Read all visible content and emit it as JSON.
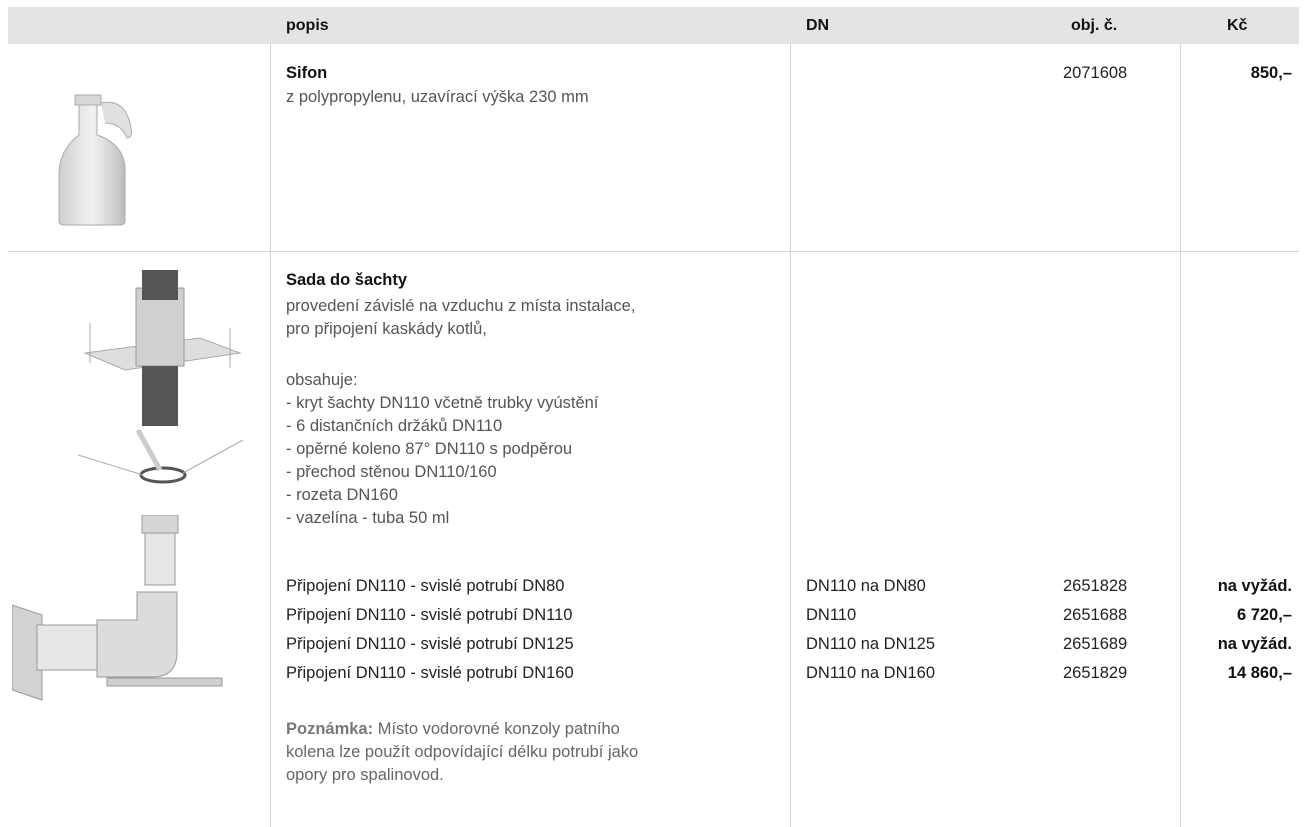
{
  "header": {
    "col_popis": "popis",
    "col_dn": "DN",
    "col_obj": "obj. č.",
    "col_kc": "Kč"
  },
  "items": [
    {
      "title": "Sifon",
      "description": "z polypropylenu, uzavírací výška 230 mm",
      "obj": "2071608",
      "price": "850,–"
    },
    {
      "title": "Sada do šachty",
      "description_lines": [
        "provedení závislé na vzduchu z místa instalace,",
        "pro připojení kaskády kotlů,"
      ],
      "contains_label": "obsahuje:",
      "contents": [
        "- kryt šachty DN110 včetně trubky vyústění",
        "- 6 distančních držáků DN110",
        "- opěrné koleno 87° DN110 s podpěrou",
        "- přechod stěnou DN110/160",
        "- rozeta DN160",
        "- vazelína - tuba 50 ml"
      ],
      "variants": [
        {
          "name": "Připojení DN110 - svislé potrubí DN80",
          "dn": "DN110 na DN80",
          "obj": "2651828",
          "price": "na vyžád."
        },
        {
          "name": "Připojení DN110 - svislé potrubí  DN110",
          "dn": "DN110",
          "obj": "2651688",
          "price": "6 720,–"
        },
        {
          "name": "Připojení DN110 - svislé potrubí  DN125",
          "dn": "DN110 na DN125",
          "obj": "2651689",
          "price": "na vyžád."
        },
        {
          "name": "Připojení DN110 - svislé potrubí  DN160",
          "dn": "DN110 na DN160",
          "obj": "2651829",
          "price": "14 860,–"
        }
      ],
      "note_label": "Poznámka:",
      "note_lines": [
        " Místo vodorovné konzoly patního",
        "kolena lze použít odpovídající délku potrubí jako",
        "opory pro spalinovod."
      ]
    }
  ]
}
